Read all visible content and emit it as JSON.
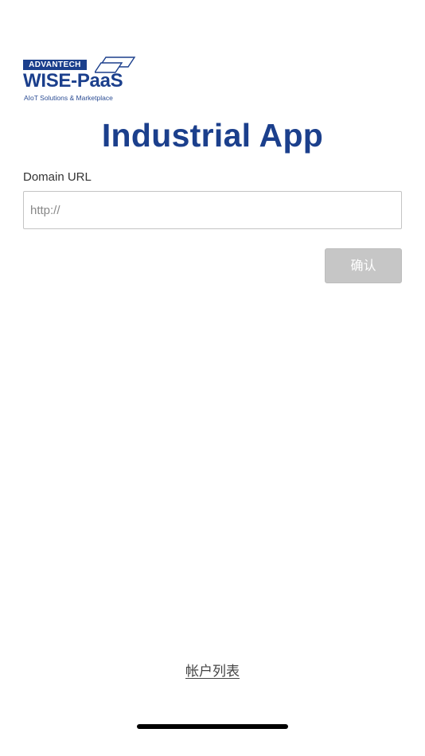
{
  "logo": {
    "brand": "ADVANTECH",
    "product": "WISE-PaaS",
    "tagline": "AIoT Solutions & Marketplace",
    "mark_icon": "overlapping-parallelograms-icon",
    "brand_color": "#1b3f8c"
  },
  "page": {
    "title": "Industrial App",
    "title_color": "#1b3f8c"
  },
  "form": {
    "domain_label": "Domain URL",
    "domain_value": "",
    "domain_placeholder": "http://",
    "confirm_label": "确认",
    "confirm_disabled_color": "#c6c6c6"
  },
  "footer": {
    "account_list_link": "帐户列表"
  }
}
